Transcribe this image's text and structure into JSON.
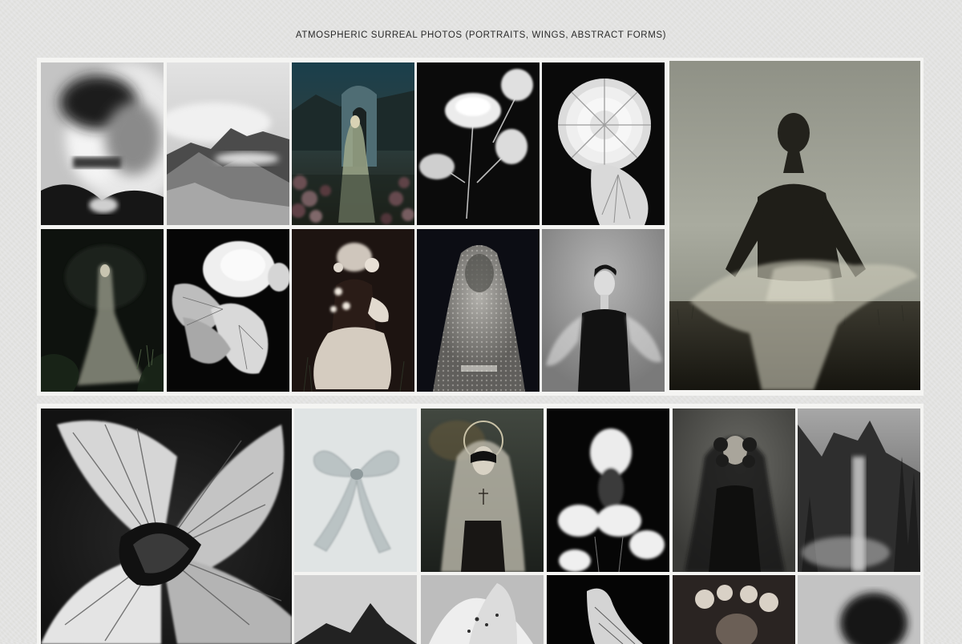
{
  "page": {
    "title": "ATMOSPHERIC SURREAL PHOTOS (PORTRAITS, WINGS, ABSTRACT FORMS)"
  },
  "photos": [
    {
      "name": "photo-blurred-portrait",
      "subject": "motion-blurred portrait of a man",
      "palette": [
        "#bdbdbd",
        "#1b1b1b"
      ]
    },
    {
      "name": "photo-misty-mountains",
      "subject": "misty mountain ridge",
      "palette": [
        "#d6d6d6",
        "#3a3a3a"
      ]
    },
    {
      "name": "photo-veiled-woman-ruins",
      "subject": "veiled woman in gown among roses before a stone arch",
      "palette": [
        "#1d3b45",
        "#2d2a22"
      ]
    },
    {
      "name": "photo-white-peonies",
      "subject": "white peonies on black",
      "palette": [
        "#0c0c0c",
        "#e8e8e8"
      ]
    },
    {
      "name": "photo-white-chrysanthemum",
      "subject": "large white chrysanthemum on black",
      "palette": [
        "#0a0a0a",
        "#efefef"
      ]
    },
    {
      "name": "photo-silhouette-field",
      "subject": "woman in flowing sheer dress in a wheat field",
      "palette": [
        "#a4a69b",
        "#1e1e1a"
      ]
    },
    {
      "name": "photo-woman-in-forest",
      "subject": "woman in gown in a dark forest",
      "palette": [
        "#0f120f",
        "#cfcfc2"
      ]
    },
    {
      "name": "photo-peony-on-black",
      "subject": "ruffled white peony on black",
      "palette": [
        "#070707",
        "#f2f2f2"
      ]
    },
    {
      "name": "photo-girl-with-flowers",
      "subject": "seated girl in vintage dress with flowers",
      "palette": [
        "#1e1512",
        "#d8d0c6"
      ]
    },
    {
      "name": "photo-lace-veil",
      "subject": "figure covered by a lace veil",
      "palette": [
        "#0c0d14",
        "#b9b7b1"
      ]
    },
    {
      "name": "photo-woman-sheer-sleeves",
      "subject": "woman with sheer sleeves and dark bodice",
      "palette": [
        "#9d9d9d",
        "#151515"
      ]
    },
    {
      "name": "photo-iris-closeup",
      "subject": "black and white iris close-up",
      "palette": [
        "#1b1b1b",
        "#dedede"
      ]
    },
    {
      "name": "photo-sheer-bow",
      "subject": "translucent ribbon bow on pale background",
      "palette": [
        "#dfe4e4",
        "#9aa6a8"
      ]
    },
    {
      "name": "photo-nun-masked",
      "subject": "masked nun with halo and veil",
      "palette": [
        "#313631",
        "#d1cdbf"
      ]
    },
    {
      "name": "photo-face-and-peonies",
      "subject": "pale face above white peonies",
      "palette": [
        "#060606",
        "#ececec"
      ]
    },
    {
      "name": "photo-veiled-woman-dark",
      "subject": "woman with curly hair under a dark veil",
      "palette": [
        "#4f4f4b",
        "#141413"
      ]
    },
    {
      "name": "photo-forest-waterfall",
      "subject": "forest cliff with waterfall mist",
      "palette": [
        "#666666",
        "#2c2c2c"
      ]
    },
    {
      "name": "photo-mountain-peak",
      "subject": "dark mountain peak in haze",
      "palette": [
        "#d4d4d4",
        "#1f1f1f"
      ]
    },
    {
      "name": "photo-lily",
      "subject": "spotted white lily",
      "palette": [
        "#cfcfcf",
        "#2d2d2d"
      ]
    },
    {
      "name": "photo-wing-detail",
      "subject": "white wing fragment on black",
      "palette": [
        "#060606",
        "#d5d5d5"
      ]
    },
    {
      "name": "photo-woman-flower-crown",
      "subject": "woman wearing a flower crown",
      "palette": [
        "#2a2422",
        "#c9c2b8"
      ]
    },
    {
      "name": "photo-blurred-head",
      "subject": "blurred dark head on pale background",
      "palette": [
        "#bdbdbd",
        "#161616"
      ]
    }
  ]
}
